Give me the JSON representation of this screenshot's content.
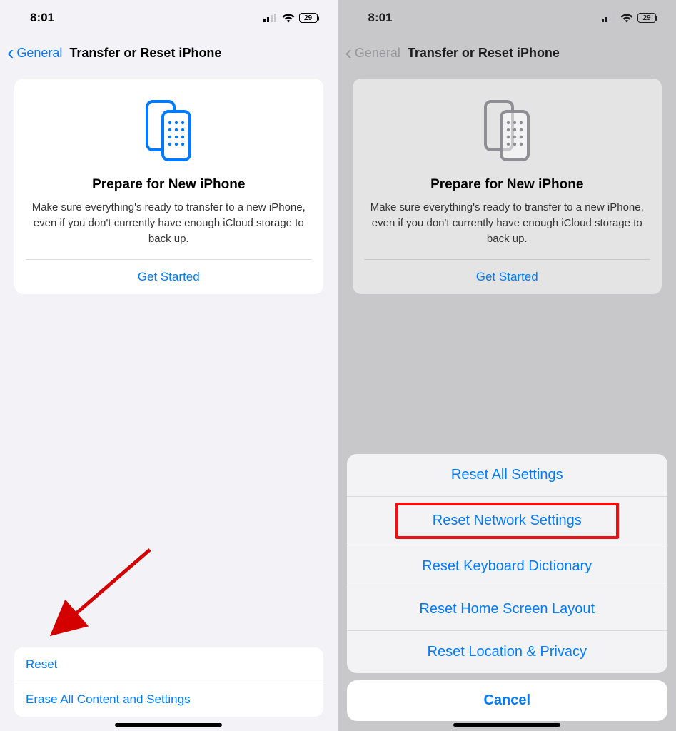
{
  "status": {
    "time": "8:01",
    "battery": "29"
  },
  "nav": {
    "back": "General",
    "title": "Transfer or Reset iPhone"
  },
  "prepare": {
    "title": "Prepare for New iPhone",
    "desc": "Make sure everything's ready to transfer to a new iPhone, even if you don't currently have enough iCloud storage to back up.",
    "cta": "Get Started"
  },
  "left_list": {
    "reset": "Reset",
    "erase": "Erase All Content and Settings"
  },
  "sheet": {
    "items": [
      "Reset All Settings",
      "Reset Network Settings",
      "Reset Keyboard Dictionary",
      "Reset Home Screen Layout",
      "Reset Location & Privacy"
    ],
    "cancel": "Cancel"
  },
  "icons": {
    "accent": "#007aff",
    "dim": "#8e8e93"
  }
}
